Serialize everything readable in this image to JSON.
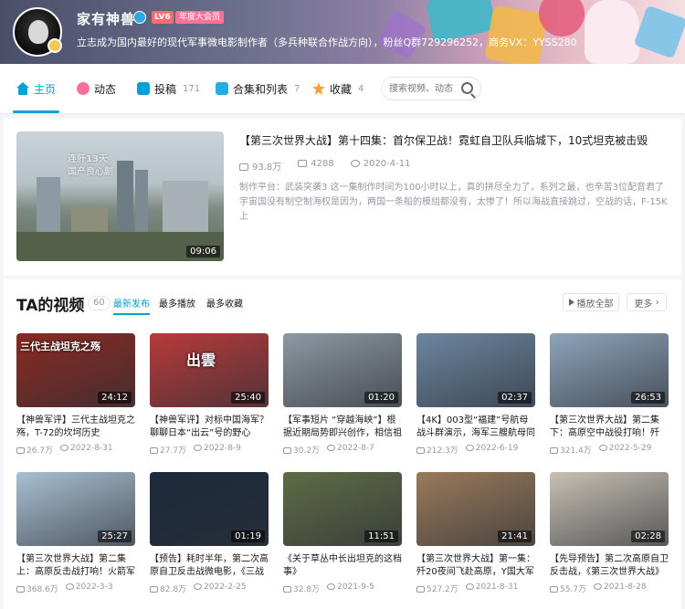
{
  "user": {
    "name": "家有神兽",
    "level": "LV6",
    "vip": "年度大会员",
    "sign": "立志成为国内最好的现代军事微电影制作者（多兵种联合作战方向），粉丝Q群729296252，商务VX：YYSS280"
  },
  "nav": {
    "items": [
      {
        "label": "主页",
        "count": ""
      },
      {
        "label": "动态",
        "count": ""
      },
      {
        "label": "投稿",
        "count": "171"
      },
      {
        "label": "合集和列表",
        "count": "7"
      },
      {
        "label": "收藏",
        "count": "4"
      }
    ],
    "search_placeholder": "搜索视频、动态"
  },
  "featured": {
    "title": "【第三次世界大战】第十四集：首尔保卫战！霓虹自卫队兵临城下，10式坦克被击毁",
    "views": "93.8万",
    "comments": "4288",
    "date": "2020-4-11",
    "desc": "制作平台：武装突袭3 这一集制作时间为100小时以上，真的拼尽全力了，系列之最，也辛苦3位配音君了 宇宙国没有制空制海权是因为，两国一条船的模组都没有，太惨了！所以海战直接跳过，空战的话，F-15K上",
    "duration": "09:06",
    "overlay": "连肝13天\n国产良心剧"
  },
  "videos": {
    "heading": "TA的视频",
    "count": "60",
    "tabs": [
      "最新发布",
      "最多播放",
      "最多收藏"
    ],
    "play_all": "播放全部",
    "more": "更多",
    "items": [
      {
        "title": "【神兽军评】三代主战坦克之殇，T-72的坎坷历史",
        "views": "26.7万",
        "date": "2022-8-31",
        "duration": "24:12",
        "caption": "三代主战坦克之殇",
        "color": "#8a2a22"
      },
      {
        "title": "【神兽军评】对标中国海军？聊聊日本“出云”号的野心",
        "views": "27.7万",
        "date": "2022-8-9",
        "duration": "25:40",
        "caption": "出雲",
        "color": "#b83a3a"
      },
      {
        "title": "【军事短片 “穿越海峡”】根据近期局势即兴创作，相信祖",
        "views": "30.2万",
        "date": "2022-8-7",
        "duration": "01:20",
        "caption": "",
        "color": "#8d99a3"
      },
      {
        "title": "【4K】003型“福建”号航母战斗群演示，海军三艘航母同",
        "views": "212.3万",
        "date": "2022-6-19",
        "duration": "02:37",
        "caption": "",
        "color": "#6c86a0"
      },
      {
        "title": "【第三次世界大战】第二集下：高原空中战役打响！歼20",
        "views": "321.4万",
        "date": "2022-5-29",
        "duration": "26:53",
        "caption": "",
        "color": "#8ea4bb"
      },
      {
        "title": "【第三次世界大战】第二集上：高原反击战打响！火箭军",
        "views": "368.6万",
        "date": "2022-3-3",
        "duration": "25:27",
        "caption": "",
        "color": "#a9bfd2"
      },
      {
        "title": "【预告】耗时半年，第二次高原自卫反击战微电影，《三战",
        "views": "82.8万",
        "date": "2022-2-25",
        "duration": "01:19",
        "caption": "",
        "color": "#1b2a3c"
      },
      {
        "title": "《关于草丛中长出坦克的这档事》",
        "views": "32.8万",
        "date": "2021-9-5",
        "duration": "11:51",
        "caption": "",
        "color": "#5f6b45"
      },
      {
        "title": "【第三次世界大战】第一集：歼20夜间飞赴高原，Y国大军",
        "views": "527.2万",
        "date": "2021-8-31",
        "duration": "21:41",
        "caption": "",
        "color": "#9a7a5a"
      },
      {
        "title": "【先导预告】第二次高原自卫反击战，《第三次世界大战》",
        "views": "55.7万",
        "date": "2021-8-28",
        "duration": "02:28",
        "caption": "",
        "color": "#c7c0b3"
      }
    ]
  },
  "colors": {
    "accent": "#00a1d6",
    "pink": "#fb7299",
    "meta": "#9499a0"
  }
}
